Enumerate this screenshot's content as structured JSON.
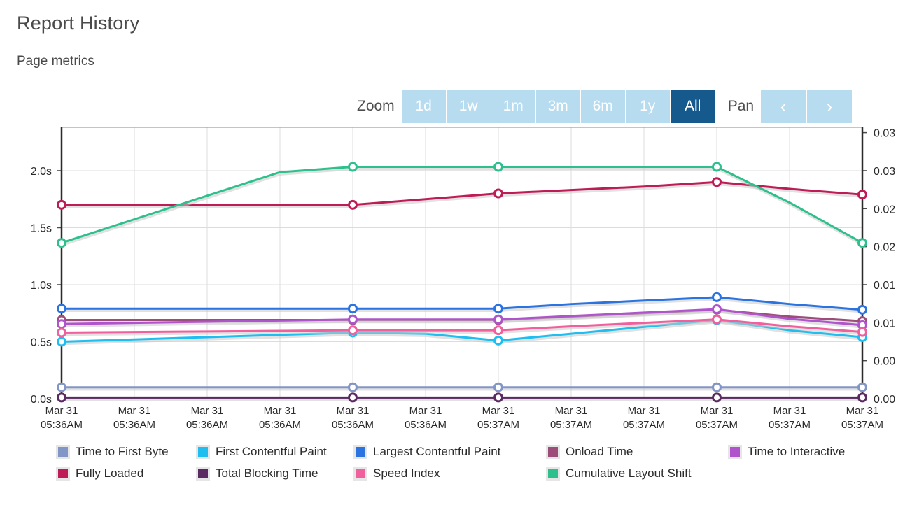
{
  "header": {
    "title": "Report History",
    "subtitle": "Page metrics"
  },
  "controls": {
    "zoom_label": "Zoom",
    "pan_label": "Pan",
    "zoom_buttons": [
      {
        "label": "1d",
        "selected": false
      },
      {
        "label": "1w",
        "selected": false
      },
      {
        "label": "1m",
        "selected": false
      },
      {
        "label": "3m",
        "selected": false
      },
      {
        "label": "6m",
        "selected": false
      },
      {
        "label": "1y",
        "selected": false
      },
      {
        "label": "All",
        "selected": true
      }
    ],
    "pan_buttons": [
      {
        "name": "pan-left-button",
        "glyph": "‹"
      },
      {
        "name": "pan-right-button",
        "glyph": "›"
      }
    ],
    "colors": {
      "button_bg": "#b7dbef",
      "button_selected_bg": "#16598c",
      "button_text": "#ffffff"
    }
  },
  "chart_data": {
    "type": "line",
    "title": "Page metrics",
    "xlabel": "",
    "ylabel": "",
    "grid": true,
    "legend_position": "bottom",
    "x": [
      "Mar 31 05:36AM",
      "Mar 31 05:36AM",
      "Mar 31 05:36AM",
      "Mar 31 05:36AM",
      "Mar 31 05:36AM",
      "Mar 31 05:36AM",
      "Mar 31 05:37AM",
      "Mar 31 05:37AM",
      "Mar 31 05:37AM",
      "Mar 31 05:37AM",
      "Mar 31 05:37AM",
      "Mar 31 05:37AM"
    ],
    "xtick_labels_line1": [
      "Mar 31",
      "Mar 31",
      "Mar 31",
      "Mar 31",
      "Mar 31",
      "Mar 31",
      "Mar 31",
      "Mar 31",
      "Mar 31",
      "Mar 31",
      "Mar 31",
      "Mar 31"
    ],
    "xtick_labels_line2": [
      "05:36AM",
      "05:36AM",
      "05:36AM",
      "05:36AM",
      "05:36AM",
      "05:36AM",
      "05:37AM",
      "05:37AM",
      "05:37AM",
      "05:37AM",
      "05:37AM",
      "05:37AM"
    ],
    "marker_indices": [
      0,
      4,
      6,
      9,
      11
    ],
    "left_axis": {
      "label": "",
      "ticks": [
        "0.0s",
        "0.5s",
        "1.0s",
        "1.5s",
        "2.0s"
      ],
      "tick_values": [
        0.0,
        0.5,
        1.0,
        1.5,
        2.0
      ],
      "ylim": [
        0.0,
        2.38
      ]
    },
    "right_axis": {
      "label": "",
      "ticks": [
        "0.00",
        "0.00",
        "0.01",
        "0.01",
        "0.02",
        "0.02",
        "0.03",
        "0.03"
      ],
      "tick_values": [
        0.0,
        0.005,
        0.01,
        0.015,
        0.02,
        0.025,
        0.03,
        0.035
      ],
      "ylim": [
        0.0,
        0.0357
      ]
    },
    "series": [
      {
        "name": "Time to First Byte",
        "color": "#8295c7",
        "axis": "left",
        "values": [
          0.1,
          0.1,
          0.1,
          0.1,
          0.1,
          0.1,
          0.1,
          0.1,
          0.1,
          0.1,
          0.1,
          0.1
        ]
      },
      {
        "name": "First Contentful Paint",
        "color": "#1fbdf0",
        "axis": "left",
        "values": [
          0.5,
          0.52,
          0.54,
          0.56,
          0.58,
          0.57,
          0.51,
          0.57,
          0.63,
          0.69,
          0.6,
          0.54
        ]
      },
      {
        "name": "Largest Contentful Paint",
        "color": "#2a73e0",
        "axis": "left",
        "values": [
          0.79,
          0.79,
          0.79,
          0.79,
          0.79,
          0.79,
          0.79,
          0.83,
          0.86,
          0.89,
          0.83,
          0.78
        ]
      },
      {
        "name": "Onload Time",
        "color": "#9c4d7a",
        "axis": "left",
        "values": [
          0.69,
          0.69,
          0.69,
          0.69,
          0.69,
          0.69,
          0.69,
          0.72,
          0.75,
          0.78,
          0.72,
          0.68
        ]
      },
      {
        "name": "Time to Interactive",
        "color": "#b054ce",
        "axis": "left",
        "values": [
          0.655,
          0.665,
          0.675,
          0.685,
          0.695,
          0.695,
          0.695,
          0.725,
          0.755,
          0.785,
          0.7,
          0.645
        ]
      },
      {
        "name": "Fully Loaded",
        "color": "#bf1b56",
        "axis": "left",
        "values": [
          1.7,
          1.7,
          1.7,
          1.7,
          1.7,
          1.75,
          1.8,
          1.83,
          1.86,
          1.9,
          1.84,
          1.79
        ]
      },
      {
        "name": "Total Blocking Time",
        "color": "#5c2a63",
        "axis": "left",
        "values": [
          0.01,
          0.01,
          0.01,
          0.01,
          0.01,
          0.01,
          0.01,
          0.01,
          0.01,
          0.01,
          0.01,
          0.01
        ]
      },
      {
        "name": "Speed Index",
        "color": "#f0609c",
        "axis": "left",
        "values": [
          0.58,
          0.585,
          0.59,
          0.595,
          0.6,
          0.6,
          0.6,
          0.635,
          0.665,
          0.695,
          0.635,
          0.585
        ]
      },
      {
        "name": "Cumulative Layout Shift",
        "color": "#2ec08c",
        "axis": "right",
        "values": [
          0.0205,
          0.0236,
          0.0267,
          0.0298,
          0.0305,
          0.0305,
          0.0305,
          0.0305,
          0.0305,
          0.0305,
          0.0258,
          0.0205
        ]
      }
    ]
  }
}
